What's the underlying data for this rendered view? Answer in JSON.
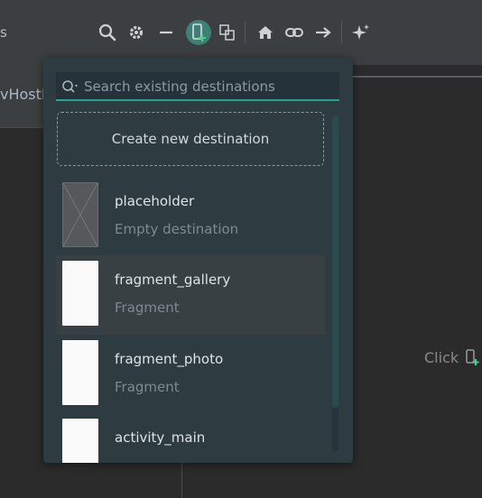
{
  "toolbar": {
    "left_label": "s",
    "icons": [
      "search-icon",
      "gear-icon",
      "minus-icon",
      "new-destination-icon",
      "copy-icon",
      "home-icon",
      "link-icon",
      "arrow-right-icon",
      "sparkle-icon"
    ]
  },
  "left_tab": {
    "label": "vHostF"
  },
  "canvas": {
    "hint_text": "Click"
  },
  "popup": {
    "search": {
      "placeholder": "Search existing destinations",
      "value": ""
    },
    "create_label": "Create new destination",
    "items": [
      {
        "name": "placeholder",
        "subtitle": "Empty destination",
        "thumb": "placeholder"
      },
      {
        "name": "fragment_gallery",
        "subtitle": "Fragment",
        "thumb": "layout",
        "selected": true
      },
      {
        "name": "fragment_photo",
        "subtitle": "Fragment",
        "thumb": "layout"
      },
      {
        "name": "activity_main",
        "subtitle": "",
        "thumb": "layout"
      }
    ]
  },
  "colors": {
    "accent": "#21a68f",
    "popup_bg": "#2e3b40",
    "toolbar_bg": "#3c3f41",
    "editor_bg": "#2b2b2b"
  }
}
